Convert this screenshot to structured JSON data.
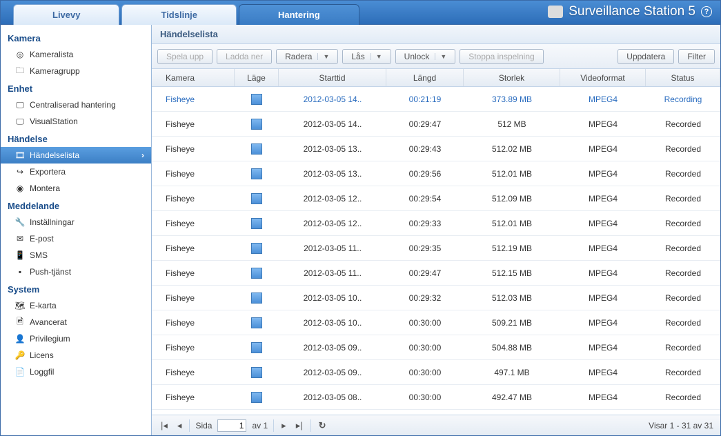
{
  "header": {
    "tabs": [
      {
        "label": "Livevy"
      },
      {
        "label": "Tidslinje"
      },
      {
        "label": "Hantering"
      }
    ],
    "activeTab": 2,
    "appTitle": "Surveillance Station 5"
  },
  "sidebar": {
    "groups": [
      {
        "title": "Kamera",
        "items": [
          {
            "label": "Kameralista",
            "icon": "◎"
          },
          {
            "label": "Kameragrupp",
            "icon": "🗀"
          }
        ]
      },
      {
        "title": "Enhet",
        "items": [
          {
            "label": "Centraliserad hantering",
            "icon": "🖵"
          },
          {
            "label": "VisualStation",
            "icon": "🖵"
          }
        ]
      },
      {
        "title": "Händelse",
        "items": [
          {
            "label": "Händelselista",
            "icon": "🎞",
            "selected": true
          },
          {
            "label": "Exportera",
            "icon": "↪"
          },
          {
            "label": "Montera",
            "icon": "◉"
          }
        ]
      },
      {
        "title": "Meddelande",
        "items": [
          {
            "label": "Inställningar",
            "icon": "🔧"
          },
          {
            "label": "E-post",
            "icon": "✉"
          },
          {
            "label": "SMS",
            "icon": "📱"
          },
          {
            "label": "Push-tjänst",
            "icon": "▪"
          }
        ]
      },
      {
        "title": "System",
        "items": [
          {
            "label": "E-karta",
            "icon": "🗺"
          },
          {
            "label": "Avancerat",
            "icon": "🖻"
          },
          {
            "label": "Privilegium",
            "icon": "👤"
          },
          {
            "label": "Licens",
            "icon": "🔑"
          },
          {
            "label": "Loggfil",
            "icon": "📄"
          }
        ]
      }
    ]
  },
  "panel": {
    "title": "Händelselista"
  },
  "toolbar": {
    "play": "Spela upp",
    "download": "Ladda ner",
    "delete": "Radera",
    "lock": "Lås",
    "unlock": "Unlock",
    "stopRec": "Stoppa inspelning",
    "refresh": "Uppdatera",
    "filter": "Filter"
  },
  "columns": {
    "camera": "Kamera",
    "mode": "Läge",
    "start": "Starttid",
    "length": "Längd",
    "size": "Storlek",
    "format": "Videoformat",
    "status": "Status"
  },
  "rows": [
    {
      "camera": "Fisheye",
      "start": "2012-03-05 14..",
      "length": "00:21:19",
      "size": "373.89 MB",
      "format": "MPEG4",
      "status": "Recording",
      "active": true
    },
    {
      "camera": "Fisheye",
      "start": "2012-03-05 14..",
      "length": "00:29:47",
      "size": "512 MB",
      "format": "MPEG4",
      "status": "Recorded"
    },
    {
      "camera": "Fisheye",
      "start": "2012-03-05 13..",
      "length": "00:29:43",
      "size": "512.02 MB",
      "format": "MPEG4",
      "status": "Recorded"
    },
    {
      "camera": "Fisheye",
      "start": "2012-03-05 13..",
      "length": "00:29:56",
      "size": "512.01 MB",
      "format": "MPEG4",
      "status": "Recorded"
    },
    {
      "camera": "Fisheye",
      "start": "2012-03-05 12..",
      "length": "00:29:54",
      "size": "512.09 MB",
      "format": "MPEG4",
      "status": "Recorded"
    },
    {
      "camera": "Fisheye",
      "start": "2012-03-05 12..",
      "length": "00:29:33",
      "size": "512.01 MB",
      "format": "MPEG4",
      "status": "Recorded"
    },
    {
      "camera": "Fisheye",
      "start": "2012-03-05 11..",
      "length": "00:29:35",
      "size": "512.19 MB",
      "format": "MPEG4",
      "status": "Recorded"
    },
    {
      "camera": "Fisheye",
      "start": "2012-03-05 11..",
      "length": "00:29:47",
      "size": "512.15 MB",
      "format": "MPEG4",
      "status": "Recorded"
    },
    {
      "camera": "Fisheye",
      "start": "2012-03-05 10..",
      "length": "00:29:32",
      "size": "512.03 MB",
      "format": "MPEG4",
      "status": "Recorded"
    },
    {
      "camera": "Fisheye",
      "start": "2012-03-05 10..",
      "length": "00:30:00",
      "size": "509.21 MB",
      "format": "MPEG4",
      "status": "Recorded"
    },
    {
      "camera": "Fisheye",
      "start": "2012-03-05 09..",
      "length": "00:30:00",
      "size": "504.88 MB",
      "format": "MPEG4",
      "status": "Recorded"
    },
    {
      "camera": "Fisheye",
      "start": "2012-03-05 09..",
      "length": "00:30:00",
      "size": "497.1 MB",
      "format": "MPEG4",
      "status": "Recorded"
    },
    {
      "camera": "Fisheye",
      "start": "2012-03-05 08..",
      "length": "00:30:00",
      "size": "492.47 MB",
      "format": "MPEG4",
      "status": "Recorded"
    }
  ],
  "pager": {
    "pageLabel": "Sida",
    "page": "1",
    "ofLabel": "av 1",
    "status": "Visar 1 - 31 av 31"
  }
}
